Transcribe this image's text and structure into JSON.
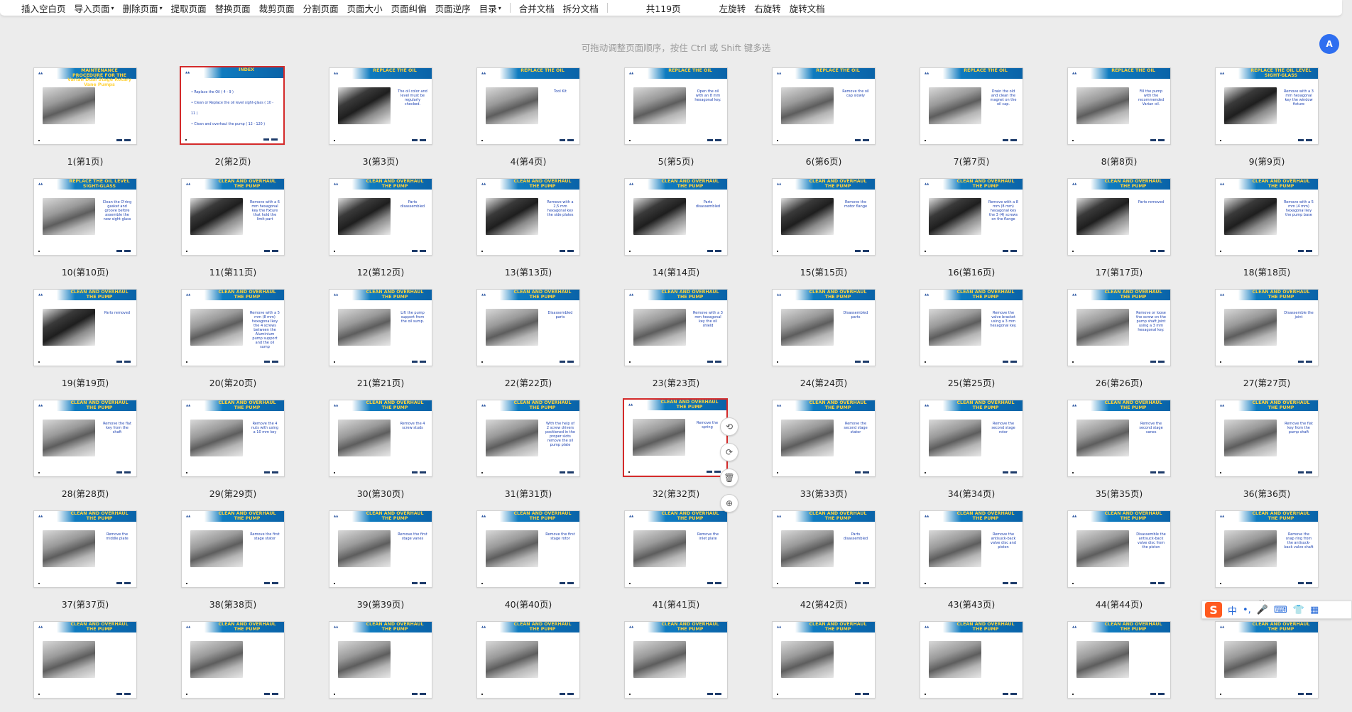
{
  "toolbar": {
    "items": [
      {
        "label": "插入空白页",
        "dropdown": false
      },
      {
        "label": "导入页面",
        "dropdown": true
      },
      {
        "label": "删除页面",
        "dropdown": true
      },
      {
        "label": "提取页面",
        "dropdown": false
      },
      {
        "label": "替换页面",
        "dropdown": false
      },
      {
        "label": "裁剪页面",
        "dropdown": false
      },
      {
        "label": "分割页面",
        "dropdown": false
      },
      {
        "label": "页面大小",
        "dropdown": false
      },
      {
        "label": "页面纠偏",
        "dropdown": false
      },
      {
        "label": "页面逆序",
        "dropdown": false
      },
      {
        "label": "目录",
        "dropdown": true
      }
    ],
    "doc_actions": [
      "合并文档",
      "拆分文档"
    ],
    "page_count": "共119页",
    "rotate_left": "左旋转",
    "rotate_right": "右旋转",
    "rotate_doc": "旋转文档"
  },
  "hint": "可拖动调整页面顺序，按住 Ctrl 或 Shift 键多选",
  "ai_button": "A",
  "pages": [
    {
      "label": "1(第1页)",
      "title": "MAINTENANCE PROCEDURE FOR THE Varian Dual Stage Rotary Vane Pumps",
      "desc": "",
      "photo": "light"
    },
    {
      "label": "2(第2页)",
      "title": "INDEX",
      "desc": "",
      "photo": "none",
      "selected": true,
      "index": [
        "• Replace the Oil ( 4 - 9 )",
        "• Clean or Replace the oil level sight-glass ( 10 - 11 )",
        "• Clean and overhaul the pump ( 12 - 120 )"
      ]
    },
    {
      "label": "3(第3页)",
      "title": "REPLACE THE OIL",
      "desc": "The oil color and level must be regularly checked.",
      "photo": "dark"
    },
    {
      "label": "4(第4页)",
      "title": "REPLACE THE OIL",
      "desc": "Tool Kit",
      "photo": "light"
    },
    {
      "label": "5(第5页)",
      "title": "REPLACE THE OIL",
      "desc": "Open the oil with an 8 mm hexagonal key.",
      "photo": "light"
    },
    {
      "label": "6(第6页)",
      "title": "REPLACE THE OIL",
      "desc": "Remove the oil cap slowly",
      "photo": "light"
    },
    {
      "label": "7(第7页)",
      "title": "REPLACE THE OIL",
      "desc": "Drain the old and clean the magnet on the oil cap.",
      "photo": "light"
    },
    {
      "label": "8(第8页)",
      "title": "REPLACE THE OIL",
      "desc": "Fill the pump with the recommended Varian oil.",
      "photo": "light"
    },
    {
      "label": "9(第9页)",
      "title": "REPLACE THE OIL LEVEL SIGHT-GLASS",
      "desc": "Remove with a 3 mm hexagonal key the window fixture",
      "photo": "dark"
    },
    {
      "label": "10(第10页)",
      "title": "REPLACE THE OIL LEVEL SIGHT-GLASS",
      "desc": "Clean the O'ring gasket and groove before assemble the new sight glass",
      "photo": "light"
    },
    {
      "label": "11(第11页)",
      "title": "CLEAN AND OVERHAUL THE PUMP",
      "desc": "Remove with a 6 mm hexagonal key the fixture that hold the limit part",
      "photo": "dark"
    },
    {
      "label": "12(第12页)",
      "title": "CLEAN AND OVERHAUL THE PUMP",
      "desc": "Parts disassembled",
      "photo": "dark"
    },
    {
      "label": "13(第13页)",
      "title": "CLEAN AND OVERHAUL THE PUMP",
      "desc": "Remove with a 2,5 mm hexagonal key the side plates",
      "photo": "dark"
    },
    {
      "label": "14(第14页)",
      "title": "CLEAN AND OVERHAUL THE PUMP",
      "desc": "Parts disassembled",
      "photo": "dark"
    },
    {
      "label": "15(第15页)",
      "title": "CLEAN AND OVERHAUL THE PUMP",
      "desc": "Remove the motor flange",
      "photo": "dark"
    },
    {
      "label": "16(第16页)",
      "title": "CLEAN AND OVERHAUL THE PUMP",
      "desc": "Remove with a 8 mm (8 mm) hexagonal key the 3 (4) screws on the flange",
      "photo": "dark"
    },
    {
      "label": "17(第17页)",
      "title": "CLEAN AND OVERHAUL THE PUMP",
      "desc": "Parts removed",
      "photo": "dark"
    },
    {
      "label": "18(第18页)",
      "title": "CLEAN AND OVERHAUL THE PUMP",
      "desc": "Remove with a 5 mm (4 mm) hexagonal key the pump base",
      "photo": "dark"
    },
    {
      "label": "19(第19页)",
      "title": "CLEAN AND OVERHAUL THE PUMP",
      "desc": "Parts removed",
      "photo": "dark"
    },
    {
      "label": "20(第20页)",
      "title": "CLEAN AND OVERHAUL THE PUMP",
      "desc": "Remove with a 5 mm (8 mm) hexagonal key the 4 screws between the Aluminium pump support and the oil sump",
      "photo": "light"
    },
    {
      "label": "21(第21页)",
      "title": "CLEAN AND OVERHAUL THE PUMP",
      "desc": "Lift the pump support from the oil sump.",
      "photo": "light"
    },
    {
      "label": "22(第22页)",
      "title": "CLEAN AND OVERHAUL THE PUMP",
      "desc": "Disassembled parts",
      "photo": "light"
    },
    {
      "label": "23(第23页)",
      "title": "CLEAN AND OVERHAUL THE PUMP",
      "desc": "Remove with a 3 mm hexagonal key the oil shield",
      "photo": "light"
    },
    {
      "label": "24(第24页)",
      "title": "CLEAN AND OVERHAUL THE PUMP",
      "desc": "Disassembled parts",
      "photo": "light"
    },
    {
      "label": "25(第25页)",
      "title": "CLEAN AND OVERHAUL THE PUMP",
      "desc": "Remove the valve bracket using a 3 mm hexagonal key.",
      "photo": "light"
    },
    {
      "label": "26(第26页)",
      "title": "CLEAN AND OVERHAUL THE PUMP",
      "desc": "Remove or loose the screw on the pump shaft joint using a 3 mm hexagonal key.",
      "photo": "light"
    },
    {
      "label": "27(第27页)",
      "title": "CLEAN AND OVERHAUL THE PUMP",
      "desc": "Disassemble the joint",
      "photo": "light"
    },
    {
      "label": "28(第28页)",
      "title": "CLEAN AND OVERHAUL THE PUMP",
      "desc": "Remove the flat key from the shaft",
      "photo": "light"
    },
    {
      "label": "29(第29页)",
      "title": "CLEAN AND OVERHAUL THE PUMP",
      "desc": "Remove the 4 nuts with using a 10 mm key",
      "photo": "light"
    },
    {
      "label": "30(第30页)",
      "title": "CLEAN AND OVERHAUL THE PUMP",
      "desc": "Remove the 4 screw studs",
      "photo": "light"
    },
    {
      "label": "31(第31页)",
      "title": "CLEAN AND OVERHAUL THE PUMP",
      "desc": "With the help of 2 screw drivers positioned in the proper slots remove the oil pump plate",
      "photo": "light"
    },
    {
      "label": "32(第32页)",
      "title": "CLEAN AND OVERHAUL THE PUMP",
      "desc": "Remove the spring",
      "photo": "light",
      "selected": true
    },
    {
      "label": "33(第33页)",
      "title": "CLEAN AND OVERHAUL THE PUMP",
      "desc": "Remove the second stage stator",
      "photo": "light"
    },
    {
      "label": "34(第34页)",
      "title": "CLEAN AND OVERHAUL THE PUMP",
      "desc": "Remove the second stage rotor",
      "photo": "light"
    },
    {
      "label": "35(第35页)",
      "title": "CLEAN AND OVERHAUL THE PUMP",
      "desc": "Remove the second stage vanes",
      "photo": "light"
    },
    {
      "label": "36(第36页)",
      "title": "CLEAN AND OVERHAUL THE PUMP",
      "desc": "Remove the flat key from the pump shaft",
      "photo": "light"
    },
    {
      "label": "37(第37页)",
      "title": "CLEAN AND OVERHAUL THE PUMP",
      "desc": "Remove the middle plate",
      "photo": "light"
    },
    {
      "label": "38(第38页)",
      "title": "CLEAN AND OVERHAUL THE PUMP",
      "desc": "Remove the first stage stator",
      "photo": "light"
    },
    {
      "label": "39(第39页)",
      "title": "CLEAN AND OVERHAUL THE PUMP",
      "desc": "Remove the first stage vanes",
      "photo": "light"
    },
    {
      "label": "40(第40页)",
      "title": "CLEAN AND OVERHAUL THE PUMP",
      "desc": "Remove the first stage rotor",
      "photo": "light"
    },
    {
      "label": "41(第41页)",
      "title": "CLEAN AND OVERHAUL THE PUMP",
      "desc": "Remove the inlet plate",
      "photo": "light"
    },
    {
      "label": "42(第42页)",
      "title": "CLEAN AND OVERHAUL THE PUMP",
      "desc": "Parts disassembled",
      "photo": "light"
    },
    {
      "label": "43(第43页)",
      "title": "CLEAN AND OVERHAUL THE PUMP",
      "desc": "Remove the antisuck-back valve disc and piston",
      "photo": "light"
    },
    {
      "label": "44(第44页)",
      "title": "CLEAN AND OVERHAUL THE PUMP",
      "desc": "Disassemble the antisuck-back valve disc from the piston",
      "photo": "light"
    },
    {
      "label": "45(第45页)",
      "title": "CLEAN AND OVERHAUL THE PUMP",
      "desc": "Remove the snap ring from the antisuck-back valve shaft",
      "photo": "light"
    },
    {
      "label": "",
      "title": "CLEAN AND OVERHAUL THE PUMP",
      "desc": "",
      "photo": "light"
    },
    {
      "label": "",
      "title": "CLEAN AND OVERHAUL THE PUMP",
      "desc": "",
      "photo": "light"
    },
    {
      "label": "",
      "title": "CLEAN AND OVERHAUL THE PUMP",
      "desc": "",
      "photo": "light"
    },
    {
      "label": "",
      "title": "CLEAN AND OVERHAUL THE PUMP",
      "desc": "",
      "photo": "light"
    },
    {
      "label": "",
      "title": "CLEAN AND OVERHAUL THE PUMP",
      "desc": "",
      "photo": "light"
    },
    {
      "label": "",
      "title": "CLEAN AND OVERHAUL THE PUMP",
      "desc": "",
      "photo": "light"
    },
    {
      "label": "",
      "title": "CLEAN AND OVERHAUL THE PUMP",
      "desc": "",
      "photo": "light"
    },
    {
      "label": "",
      "title": "CLEAN AND OVERHAUL THE PUMP",
      "desc": "",
      "photo": "light"
    },
    {
      "label": "",
      "title": "CLEAN AND OVERHAUL THE PUMP",
      "desc": "",
      "photo": "light"
    }
  ],
  "float_tools": [
    "rotate-left-icon",
    "rotate-right-icon",
    "delete-icon",
    "insert-icon"
  ],
  "ime": {
    "logo": "S",
    "mode": "中",
    "punct": "•,",
    "icons": [
      "mic-icon",
      "keyboard-icon",
      "skin-icon",
      "grid-icon"
    ]
  },
  "colors": {
    "selected_border": "#d42a2a",
    "banner_blue": "#0a63a8",
    "title_yellow": "#ffd23a"
  }
}
